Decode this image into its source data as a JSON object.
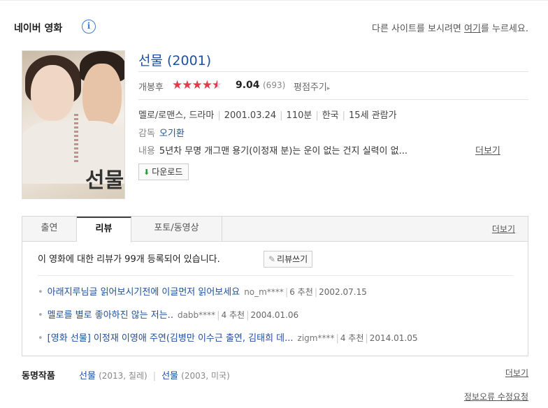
{
  "header": {
    "brand": "네이버 영화",
    "info_icon": "info-icon",
    "notice_prefix": "다른 사이트를 보시려면 ",
    "notice_link": "여기",
    "notice_suffix": "를 누르세요."
  },
  "movie": {
    "title": "선물 (2001)",
    "poster_title_art": "선물",
    "rating_label": "개봉후",
    "rating_stars": 4.5,
    "score": "9.04",
    "rating_count": "(693)",
    "rate_link": "평점주기",
    "genre": "멜로/로맨스, 드라마",
    "release_date": "2001.03.24",
    "runtime": "110분",
    "country": "한국",
    "age_rating": "15세 관람가",
    "director_label": "감독",
    "director": "오기환",
    "plot_label": "내용",
    "plot": "5년차 무명 개그맨 용기(이정재 분)는 운이 없는 건지 실력이 없...",
    "plot_more": "더보기",
    "download": "다운로드"
  },
  "tabs": {
    "items": [
      "출연",
      "리뷰",
      "포토/동영상"
    ],
    "active": "리뷰",
    "more": "더보기"
  },
  "reviews": {
    "summary_prefix": "이 영화에 대한 리뷰가 ",
    "summary_count": "99",
    "summary_suffix": "개 등록되어 있습니다.",
    "write_button": "리뷰쓰기",
    "items": [
      {
        "title": "아래지루님글 읽어보시기전에 이글먼저 읽어보세요",
        "user": "no_m****",
        "recommend": "6 추천",
        "date": "2002.07.15"
      },
      {
        "title": "멜로를 별로 좋아하진 않는 저는..",
        "user": "dabb****",
        "recommend": "4 추천",
        "date": "2004.01.06"
      },
      {
        "title": "[영화 선물] 이정재 이영애 주연(김병만 이수근 출연, 김태희 데...",
        "user": "zigm****",
        "recommend": "4 추천",
        "date": "2014.01.05"
      }
    ]
  },
  "same_title": {
    "label": "동명작품",
    "items": [
      {
        "name": "선물",
        "info": "(2013, 칠레)"
      },
      {
        "name": "선물",
        "info": "(2003, 미국)"
      }
    ],
    "more": "더보기"
  },
  "report_link": "정보오류 수정요청",
  "colors": {
    "link_blue": "#1f50a0",
    "star_red": "#e23b4a",
    "info_blue": "#3d7fd1",
    "download_green": "#2a9a3b"
  }
}
